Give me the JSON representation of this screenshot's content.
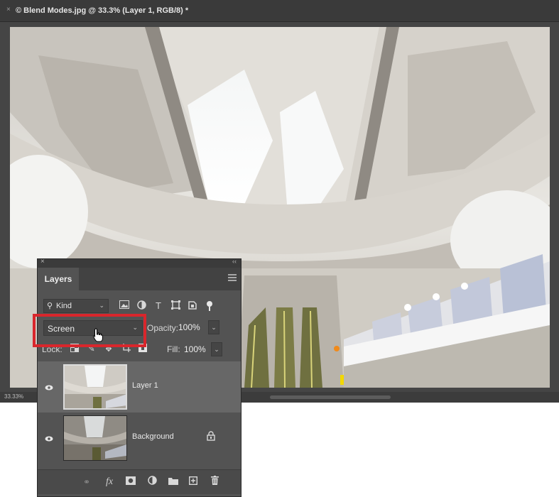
{
  "document": {
    "close_glyph": "×",
    "title": "© Blend Modes.jpg @ 33.3% (Layer 1, RGB/8) *",
    "zoom_status": "33.33%"
  },
  "layers_panel": {
    "close_glyph": "×",
    "collapse_glyph": "‹‹",
    "tab_label": "Layers",
    "filter": {
      "kind_label": "Kind",
      "icons": [
        "pixel-layer-filter-icon",
        "adjustment-layer-filter-icon",
        "type-layer-filter-icon",
        "shape-layer-filter-icon",
        "smart-object-filter-icon",
        "filter-toggle-icon"
      ]
    },
    "blend_mode": "Screen",
    "opacity_label": "Opacity:",
    "opacity_value": "100%",
    "lock_label": "Lock:",
    "fill_label": "Fill:",
    "fill_value": "100%",
    "layers": [
      {
        "name": "Layer 1",
        "selected": true,
        "visible": true,
        "locked": false
      },
      {
        "name": "Background",
        "selected": false,
        "visible": true,
        "locked": true
      }
    ],
    "footer_icons": [
      "link-layers-icon",
      "fx-icon",
      "add-mask-icon",
      "adjustment-layer-icon",
      "new-group-icon",
      "new-layer-icon",
      "delete-layer-icon"
    ],
    "fx_label": "fx"
  },
  "colors": {
    "highlight": "#d9262c",
    "panel_bg": "#535353",
    "selected_row": "#676767"
  }
}
